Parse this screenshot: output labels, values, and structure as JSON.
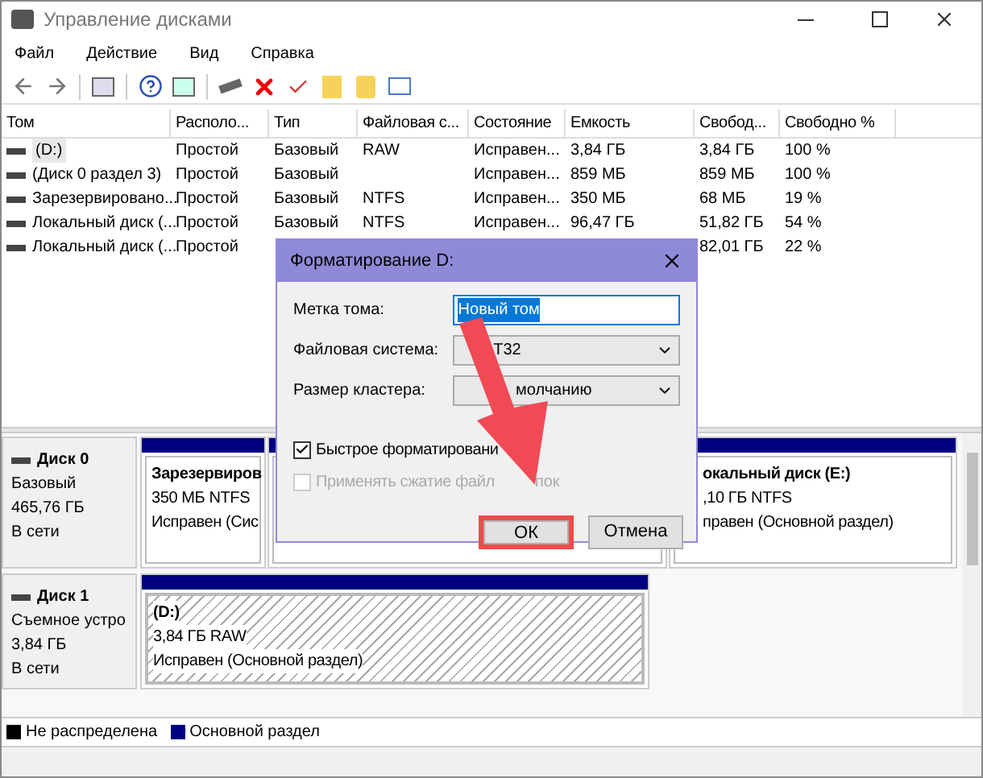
{
  "window": {
    "title": "Управление дисками"
  },
  "menu": [
    "Файл",
    "Действие",
    "Вид",
    "Справка"
  ],
  "table": {
    "columns": [
      "Том",
      "Располо...",
      "Тип",
      "Файловая с...",
      "Состояние",
      "Емкость",
      "Свобод...",
      "Свободно %"
    ],
    "rows": [
      {
        "cells": [
          "(D:)",
          "Простой",
          "Базовый",
          "RAW",
          "Исправен...",
          "3,84 ГБ",
          "3,84 ГБ",
          "100 %"
        ],
        "selected": true
      },
      {
        "cells": [
          "(Диск 0 раздел 3)",
          "Простой",
          "Базовый",
          null,
          "Исправен...",
          "859 МБ",
          "859 МБ",
          "100 %"
        ],
        "selected": false
      },
      {
        "cells": [
          "Зарезервировано...",
          "Простой",
          "Базовый",
          "NTFS",
          "Исправен...",
          "350 МБ",
          "68 МБ",
          "19 %"
        ],
        "selected": false
      },
      {
        "cells": [
          "Локальный диск (...",
          "Простой",
          "Базовый",
          "NTFS",
          "Исправен...",
          "96,47 ГБ",
          "51,82 ГБ",
          "54 %"
        ],
        "selected": false
      },
      {
        "cells": [
          "Локальный диск (...",
          "Простой",
          null,
          null,
          null,
          null,
          "82,01 ГБ",
          "22 %"
        ],
        "selected": false
      }
    ]
  },
  "disks": [
    {
      "name": "Диск 0",
      "lines": [
        "Базовый",
        "465,76 ГБ",
        "В сети"
      ],
      "partitions": [
        {
          "kind": "primary",
          "lines": [
            "Зарезервиров",
            "350 МБ NTFS",
            "Исправен (Сис"
          ]
        },
        {
          "kind": "primary"
        },
        {
          "kind": "primary",
          "lines": [
            "окальный диск  (E:)",
            ",10 ГБ NTFS",
            "правен (Основной раздел)"
          ]
        }
      ]
    },
    {
      "name": "Диск 1",
      "lines": [
        "Съемное устро",
        "3,84 ГБ",
        "В сети"
      ],
      "partitions": [
        {
          "kind": "raw",
          "lines": [
            "(D:)",
            "3,84 ГБ RAW",
            "Исправен (Основной раздел)"
          ]
        }
      ]
    }
  ],
  "legend": [
    {
      "label": "Не распределена",
      "color": "#000000"
    },
    {
      "label": "Основной раздел",
      "color": "#000080"
    }
  ],
  "dialog": {
    "title": "Форматирование D:",
    "fields": [
      {
        "kind": "text",
        "label": "Метка тома:",
        "value": "Новый том"
      },
      {
        "kind": "select",
        "label": "Файловая система:",
        "value": "T32"
      },
      {
        "kind": "select",
        "label": "Размер кластера:",
        "value": "молчанию"
      }
    ],
    "checkboxes": [
      {
        "label": "Быстрое форматировани",
        "checked": true,
        "disabled": false
      },
      {
        "label": "Применять сжатие файл",
        "tail": "пок",
        "checked": false,
        "disabled": true
      }
    ],
    "buttons": [
      {
        "label": "ОК",
        "highlighted": true
      },
      {
        "label": "Отмена",
        "highlighted": false
      }
    ]
  }
}
